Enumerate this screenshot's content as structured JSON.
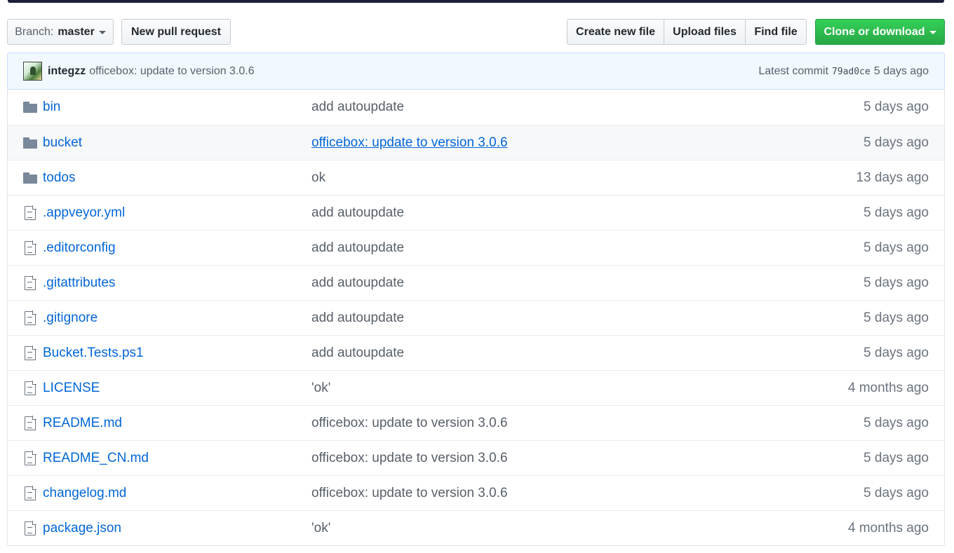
{
  "toolbar": {
    "branch_prefix": "Branch:",
    "branch_name": "master",
    "new_pull_request": "New pull request",
    "create_new_file": "Create new file",
    "upload_files": "Upload files",
    "find_file": "Find file",
    "clone_or_download": "Clone or download"
  },
  "latest_commit": {
    "author": "integzz",
    "message": "officebox: update to version 3.0.6",
    "label": "Latest commit",
    "sha": "79ad0ce",
    "age": "5 days ago"
  },
  "files": [
    {
      "type": "folder",
      "icon": "folder-icon",
      "name": "bin",
      "message": "add autoupdate",
      "age": "5 days ago"
    },
    {
      "type": "folder",
      "icon": "folder-icon",
      "name": "bucket",
      "message": "officebox: update to version 3.0.6",
      "age": "5 days ago",
      "hover": true
    },
    {
      "type": "folder",
      "icon": "folder-icon",
      "name": "todos",
      "message": "ok",
      "age": "13 days ago"
    },
    {
      "type": "file",
      "icon": "file-icon",
      "name": ".appveyor.yml",
      "message": "add autoupdate",
      "age": "5 days ago"
    },
    {
      "type": "file",
      "icon": "file-icon",
      "name": ".editorconfig",
      "message": "add autoupdate",
      "age": "5 days ago"
    },
    {
      "type": "file",
      "icon": "file-icon",
      "name": ".gitattributes",
      "message": "add autoupdate",
      "age": "5 days ago"
    },
    {
      "type": "file",
      "icon": "file-icon",
      "name": ".gitignore",
      "message": "add autoupdate",
      "age": "5 days ago"
    },
    {
      "type": "file",
      "icon": "file-icon",
      "name": "Bucket.Tests.ps1",
      "message": "add autoupdate",
      "age": "5 days ago"
    },
    {
      "type": "file",
      "icon": "file-icon",
      "name": "LICENSE",
      "message": "'ok'",
      "age": "4 months ago"
    },
    {
      "type": "file",
      "icon": "file-icon",
      "name": "README.md",
      "message": "officebox: update to version 3.0.6",
      "age": "5 days ago"
    },
    {
      "type": "file",
      "icon": "file-icon",
      "name": "README_CN.md",
      "message": "officebox: update to version 3.0.6",
      "age": "5 days ago"
    },
    {
      "type": "file",
      "icon": "file-icon",
      "name": "changelog.md",
      "message": "officebox: update to version 3.0.6",
      "age": "5 days ago"
    },
    {
      "type": "file",
      "icon": "file-icon",
      "name": "package.json",
      "message": "'ok'",
      "age": "4 months ago"
    }
  ],
  "colors": {
    "link": "#0366d6",
    "clone_button": "#28a745",
    "commit_bar": "#f1f8ff"
  }
}
